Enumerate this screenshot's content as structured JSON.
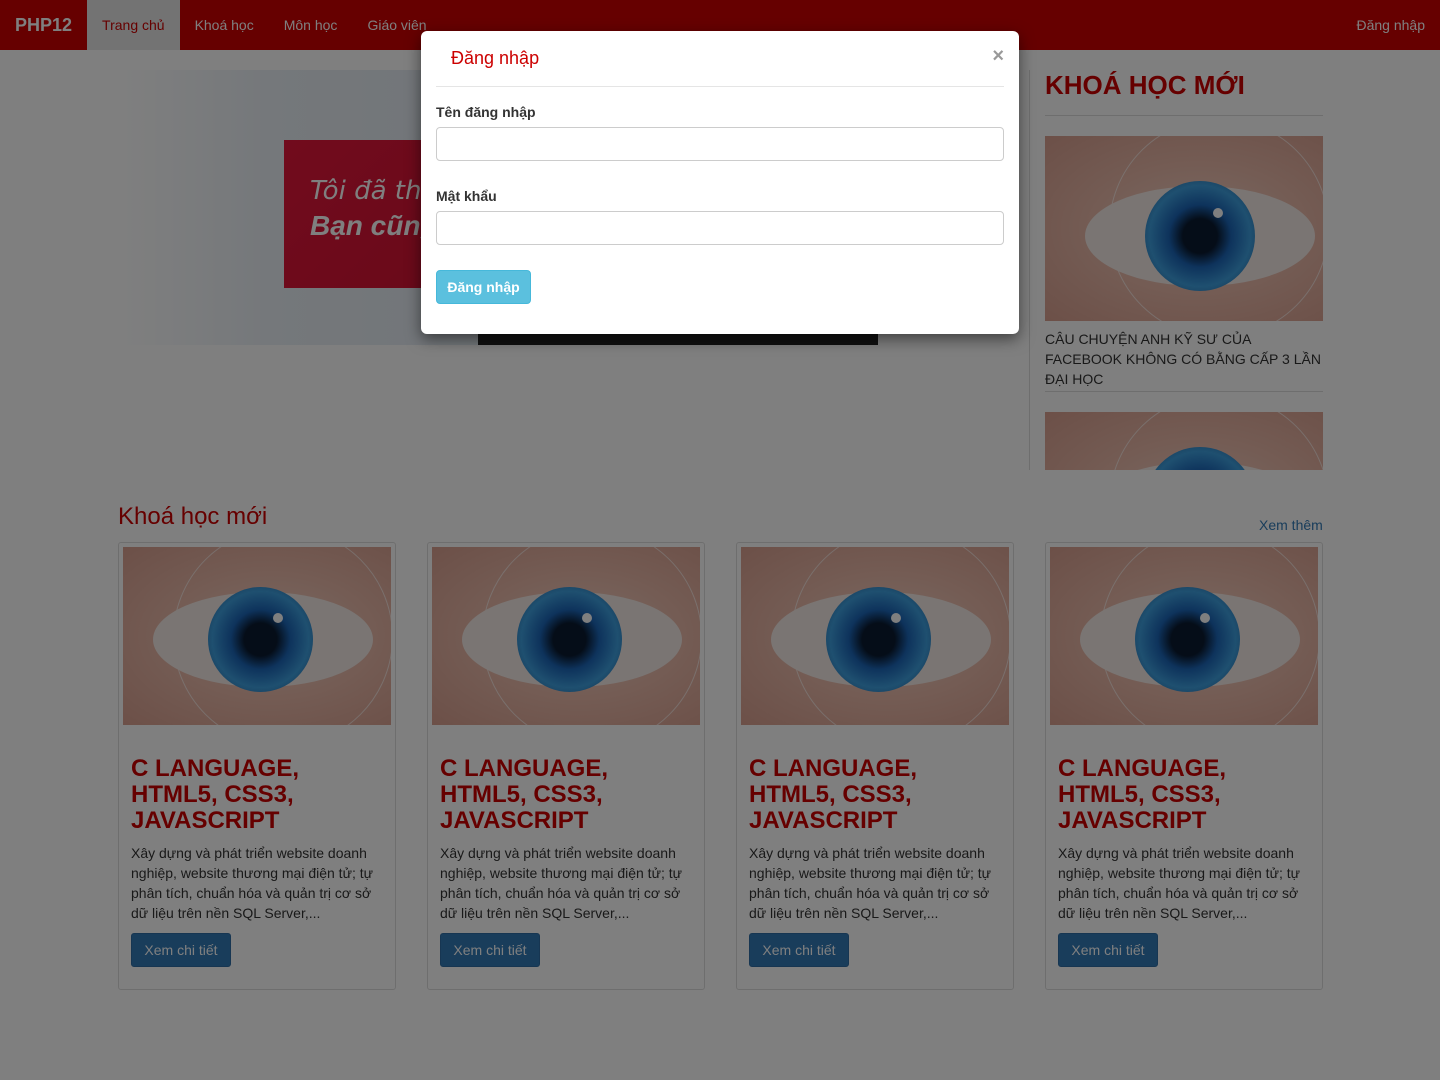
{
  "navbar": {
    "brand": "PHP12",
    "items": [
      {
        "label": "Trang chủ",
        "active": true
      },
      {
        "label": "Khoá học",
        "active": false
      },
      {
        "label": "Môn học",
        "active": false
      },
      {
        "label": "Giáo viên",
        "active": false
      }
    ],
    "login": "Đăng nhập"
  },
  "hero": {
    "line1": "Tôi đã thà",
    "line2": "Bạn cũng"
  },
  "sidebar": {
    "title": "KHOÁ HỌC MỚI",
    "items": [
      {
        "caption": "CÂU CHUYỆN ANH KỸ SƯ CỦA FACEBOOK KHÔNG CÓ BẰNG CẤP 3 LẦN ĐẠI HỌC"
      }
    ]
  },
  "section": {
    "title": "Khoá học mới",
    "more": "Xem thêm"
  },
  "courses": [
    {
      "title": "C LANGUAGE, HTML5, CSS3, JAVASCRIPT",
      "desc": "Xây dựng và phát triển website doanh nghiệp, website thương mại điện tử; tự phân tích, chuẩn hóa và quản trị cơ sở dữ liệu trên nền SQL Server,...",
      "button": "Xem chi tiết"
    },
    {
      "title": "C LANGUAGE, HTML5, CSS3, JAVASCRIPT",
      "desc": "Xây dựng và phát triển website doanh nghiệp, website thương mại điện tử; tự phân tích, chuẩn hóa và quản trị cơ sở dữ liệu trên nền SQL Server,...",
      "button": "Xem chi tiết"
    },
    {
      "title": "C LANGUAGE, HTML5, CSS3, JAVASCRIPT",
      "desc": "Xây dựng và phát triển website doanh nghiệp, website thương mại điện tử; tự phân tích, chuẩn hóa và quản trị cơ sở dữ liệu trên nền SQL Server,...",
      "button": "Xem chi tiết"
    },
    {
      "title": "C LANGUAGE, HTML5, CSS3, JAVASCRIPT",
      "desc": "Xây dựng và phát triển website doanh nghiệp, website thương mại điện tử; tự phân tích, chuẩn hóa và quản trị cơ sở dữ liệu trên nền SQL Server,...",
      "button": "Xem chi tiết"
    }
  ],
  "modal": {
    "title": "Đăng nhập",
    "close": "×",
    "username_label": "Tên đăng nhập",
    "username_value": "",
    "password_label": "Mật khẩu",
    "password_value": "",
    "submit": "Đăng nhập"
  },
  "colors": {
    "brand_red": "#cc0000",
    "primary_blue": "#337ab7",
    "info_cyan": "#5bc0de"
  },
  "icons": {
    "close": "close-icon",
    "course_image": "eye-image"
  }
}
